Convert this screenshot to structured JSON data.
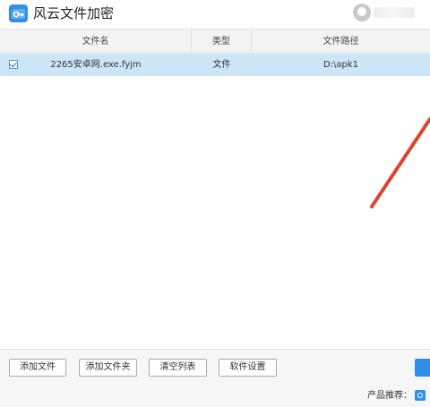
{
  "app": {
    "title": "风云文件加密"
  },
  "table": {
    "columns": {
      "name": "文件名",
      "type": "类型",
      "path": "文件路径"
    },
    "rows": [
      {
        "checked": true,
        "name": "2265安卓网.exe.fyjm",
        "type": "文件",
        "path": "D:\\apk1"
      }
    ]
  },
  "toolbar": {
    "add_file_label": "添加文件",
    "add_folder_label": "添加文件夹",
    "clear_list_label": "清空列表",
    "settings_label": "软件设置"
  },
  "footer": {
    "recommend_label": "产品推荐："
  },
  "colors": {
    "accent": "#2f8fe8",
    "selected_row": "#cce6f8",
    "annotation_arrow": "#d9452f"
  }
}
